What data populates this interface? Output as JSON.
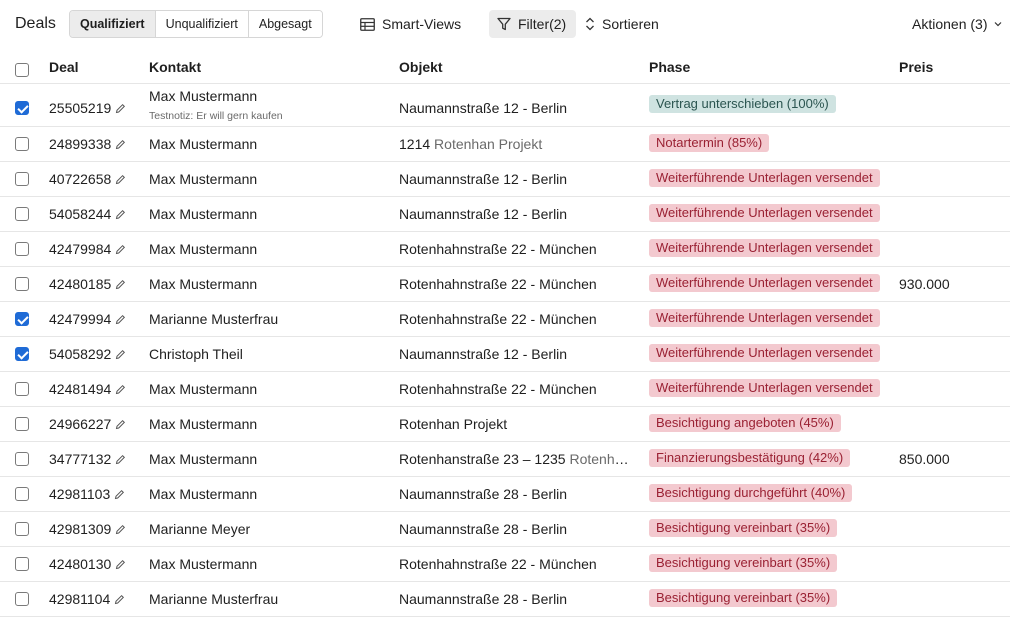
{
  "toolbar": {
    "title": "Deals",
    "segments": [
      "Qualifiziert",
      "Unqualifiziert",
      "Abgesagt"
    ],
    "smart_views": "Smart-Views",
    "filter": "Filter(2)",
    "sort": "Sortieren",
    "actions": "Aktionen (3)"
  },
  "columns": [
    "Deal",
    "Kontakt",
    "Objekt",
    "Phase",
    "Preis"
  ],
  "colors": {
    "accent": "#1f6bd6",
    "phase_red_bg": "#f3c9cf",
    "phase_red_text": "#9a2133",
    "phase_teal_bg": "#cfe3e1",
    "phase_teal_text": "#2b5550"
  },
  "rows": [
    {
      "checked": true,
      "deal": "25505219",
      "contact": "Max Mustermann",
      "note": "Testnotiz: Er will gern kaufen",
      "object": "Naumannstraße 12 - Berlin",
      "object_muted": "",
      "phase": "Vertrag unterschieben (100%)",
      "phase_color": "teal",
      "price": ""
    },
    {
      "checked": false,
      "deal": "24899338",
      "contact": "Max Mustermann",
      "note": "",
      "object": "1214",
      "object_muted": "Rotenhan Projekt",
      "phase": "Notartermin (85%)",
      "phase_color": "red",
      "price": ""
    },
    {
      "checked": false,
      "deal": "40722658",
      "contact": "Max Mustermann",
      "note": "",
      "object": "Naumannstraße 12 - Berlin",
      "object_muted": "",
      "phase": "Weiterführende Unterlagen versendet",
      "phase_color": "red",
      "price": ""
    },
    {
      "checked": false,
      "deal": "54058244",
      "contact": "Max Mustermann",
      "note": "",
      "object": "Naumannstraße 12 - Berlin",
      "object_muted": "",
      "phase": "Weiterführende Unterlagen versendet",
      "phase_color": "red",
      "price": ""
    },
    {
      "checked": false,
      "deal": "42479984",
      "contact": "Max Mustermann",
      "note": "",
      "object": "Rotenhahnstraße 22 - München",
      "object_muted": "",
      "phase": "Weiterführende Unterlagen versendet",
      "phase_color": "red",
      "price": ""
    },
    {
      "checked": false,
      "deal": "42480185",
      "contact": "Max Mustermann",
      "note": "",
      "object": "Rotenhahnstraße 22 - München",
      "object_muted": "",
      "phase": "Weiterführende Unterlagen versendet",
      "phase_color": "red",
      "price": "930.000"
    },
    {
      "checked": true,
      "deal": "42479994",
      "contact": "Marianne Musterfrau",
      "note": "",
      "object": "Rotenhahnstraße 22 - München",
      "object_muted": "",
      "phase": "Weiterführende Unterlagen versendet",
      "phase_color": "red",
      "price": ""
    },
    {
      "checked": true,
      "deal": "54058292",
      "contact": "Christoph Theil",
      "note": "",
      "object": "Naumannstraße 12 - Berlin",
      "object_muted": "",
      "phase": "Weiterführende Unterlagen versendet",
      "phase_color": "red",
      "price": ""
    },
    {
      "checked": false,
      "deal": "42481494",
      "contact": "Max Mustermann",
      "note": "",
      "object": "Rotenhahnstraße 22 - München",
      "object_muted": "",
      "phase": "Weiterführende Unterlagen versendet",
      "phase_color": "red",
      "price": ""
    },
    {
      "checked": false,
      "deal": "24966227",
      "contact": "Max Mustermann",
      "note": "",
      "object": "Rotenhan Projekt",
      "object_muted": "",
      "phase": "Besichtigung angeboten (45%)",
      "phase_color": "red",
      "price": ""
    },
    {
      "checked": false,
      "deal": "34777132",
      "contact": "Max Mustermann",
      "note": "",
      "object": "Rotenhanstraße 23 – 1235",
      "object_muted": "Rotenhan Projekt",
      "phase": "Finanzierungsbestätigung (42%)",
      "phase_color": "red",
      "price": "850.000"
    },
    {
      "checked": false,
      "deal": "42981103",
      "contact": "Max Mustermann",
      "note": "",
      "object": "Naumannstraße 28 - Berlin",
      "object_muted": "",
      "phase": "Besichtigung durchgeführt (40%)",
      "phase_color": "red",
      "price": ""
    },
    {
      "checked": false,
      "deal": "42981309",
      "contact": "Marianne Meyer",
      "note": "",
      "object": "Naumannstraße 28 - Berlin",
      "object_muted": "",
      "phase": "Besichtigung vereinbart (35%)",
      "phase_color": "red",
      "price": ""
    },
    {
      "checked": false,
      "deal": "42480130",
      "contact": "Max Mustermann",
      "note": "",
      "object": "Rotenhahnstraße 22 - München",
      "object_muted": "",
      "phase": "Besichtigung vereinbart (35%)",
      "phase_color": "red",
      "price": ""
    },
    {
      "checked": false,
      "deal": "42981104",
      "contact": "Marianne Musterfrau",
      "note": "",
      "object": "Naumannstraße 28 - Berlin",
      "object_muted": "",
      "phase": "Besichtigung vereinbart (35%)",
      "phase_color": "red",
      "price": ""
    }
  ]
}
